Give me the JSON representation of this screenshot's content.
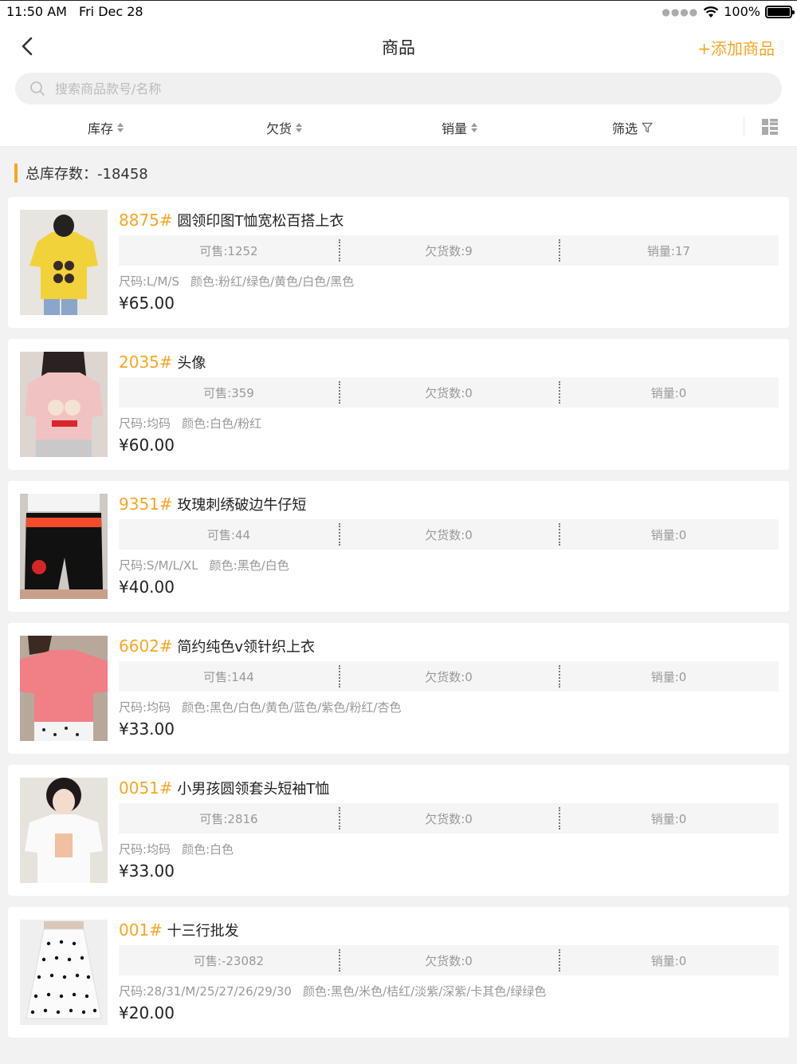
{
  "status_bar": {
    "time": "11:50 AM",
    "date": "Fri Dec 28",
    "battery": "100%"
  },
  "nav": {
    "title": "商品",
    "add_label": "+添加商品"
  },
  "search": {
    "placeholder": "搜索商品款号/名称",
    "value": ""
  },
  "sort_bar": {
    "items": [
      {
        "label": "库存"
      },
      {
        "label": "欠货"
      },
      {
        "label": "销量"
      },
      {
        "label": "筛选"
      }
    ]
  },
  "summary": {
    "total_stock": "总库存数：-18458"
  },
  "products": [
    {
      "code": "8875#",
      "name": "圆领印图T恤宽松百搭上衣",
      "available": "可售:1252",
      "owed": "欠货数:9",
      "sales": "销量:17",
      "sizes": "尺码:L/M/S",
      "colors": "颜色:粉红/绿色/黄色/白色/黑色",
      "price": "¥65.00"
    },
    {
      "code": "2035#",
      "name": "头像",
      "available": "可售:359",
      "owed": "欠货数:0",
      "sales": "销量:0",
      "sizes": "尺码:均码",
      "colors": "颜色:白色/粉红",
      "price": "¥60.00"
    },
    {
      "code": "9351#",
      "name": "玫瑰刺绣破边牛仔短",
      "available": "可售:44",
      "owed": "欠货数:0",
      "sales": "销量:0",
      "sizes": "尺码:S/M/L/XL",
      "colors": "颜色:黑色/白色",
      "price": "¥40.00"
    },
    {
      "code": "6602#",
      "name": "简约纯色v领针织上衣",
      "available": "可售:144",
      "owed": "欠货数:0",
      "sales": "销量:0",
      "sizes": "尺码:均码",
      "colors": "颜色:黑色/白色/黄色/蓝色/紫色/粉红/杏色",
      "price": "¥33.00"
    },
    {
      "code": "0051#",
      "name": "小男孩圆领套头短袖T恤",
      "available": "可售:2816",
      "owed": "欠货数:0",
      "sales": "销量:0",
      "sizes": "尺码:均码",
      "colors": "颜色:白色",
      "price": "¥33.00"
    },
    {
      "code": "001#",
      "name": "十三行批发",
      "available": "可售:-23082",
      "owed": "欠货数:0",
      "sales": "销量:0",
      "sizes": "尺码:28/31/M/25/27/26/29/30",
      "colors": "颜色:黑色/米色/桔红/淡紫/深紫/卡其色/绿绿色",
      "price": "¥20.00"
    }
  ],
  "colors": {
    "accent": "#f5a623",
    "background": "#f2f2f2"
  }
}
